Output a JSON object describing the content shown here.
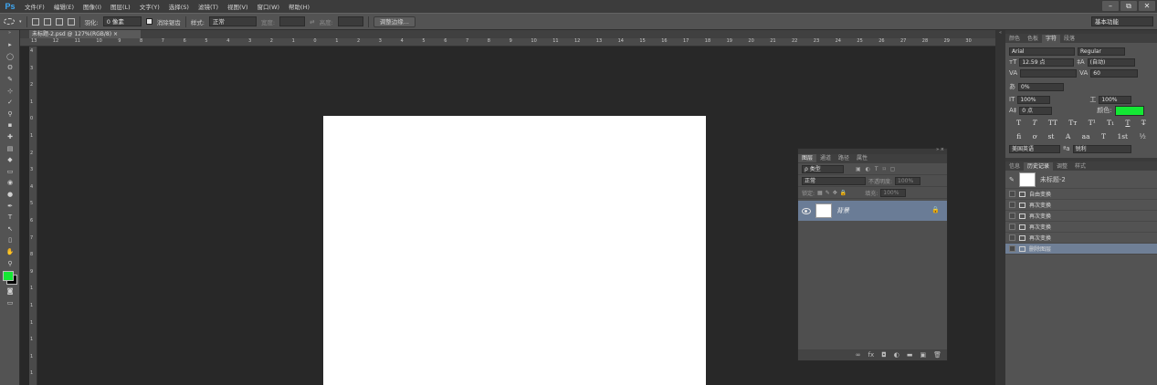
{
  "app": {
    "logo": "Ps"
  },
  "menu": [
    "文件(F)",
    "编辑(E)",
    "图像(I)",
    "图层(L)",
    "文字(Y)",
    "选择(S)",
    "滤镜(T)",
    "视图(V)",
    "窗口(W)",
    "帮助(H)"
  ],
  "window_controls": [
    "–",
    "⧉",
    "✕"
  ],
  "options": {
    "feather_label": "羽化:",
    "feather_value": "0 像素",
    "antialias_label": "消除锯齿",
    "style_label": "样式:",
    "style_value": "正常",
    "width_label": "宽度:",
    "height_label": "高度:",
    "refine_edge_button": "调整边缘...",
    "workspace": "基本功能"
  },
  "tools": [
    "▸",
    "◯",
    "ʘ",
    "✎",
    "⊹",
    "✓",
    "⚲",
    "▪",
    "✚",
    "▤",
    "◆",
    "▭",
    "◉",
    "●",
    "✒",
    "T",
    "↖",
    "▯",
    "✋",
    "⚲"
  ],
  "document": {
    "tab_title": "未标题-2.psd @ 127%(RGB/8) ×"
  },
  "ruler": {
    "h_ticks": [
      "13",
      "12",
      "11",
      "10",
      "9",
      "8",
      "7",
      "6",
      "5",
      "4",
      "3",
      "2",
      "1",
      "0",
      "1",
      "2",
      "3",
      "4",
      "5",
      "6",
      "7",
      "8",
      "9",
      "10",
      "11",
      "12",
      "13",
      "14",
      "15",
      "16",
      "17",
      "18",
      "19",
      "20",
      "21",
      "22",
      "23",
      "24",
      "25",
      "26",
      "27",
      "28",
      "29",
      "30"
    ],
    "v_ticks": [
      "4",
      "3",
      "2",
      "1",
      "0",
      "1",
      "2",
      "3",
      "4",
      "5",
      "6",
      "7",
      "8",
      "9",
      "1",
      "1",
      "1",
      "1",
      "1",
      "1"
    ]
  },
  "character_panel": {
    "tabs": [
      "颜色",
      "色板",
      "字符",
      "段落"
    ],
    "font_family": "Arial",
    "font_style": "Regular",
    "font_size": "12.59 点",
    "leading": "(自动)",
    "tracking": "60",
    "vertical_scale": "100%",
    "horizontal_scale": "100%",
    "baseline_label_value": "0%",
    "baseline_shift": "0 点",
    "color_label": "颜色:",
    "color_hex": "#14e834",
    "glyphs": [
      "T",
      "T",
      "TT",
      "Tт",
      "T¹",
      "T₁",
      "T",
      "T̶"
    ],
    "glyphs2": [
      "fi",
      "ơ",
      "st",
      "A",
      "aa",
      "T",
      "1st",
      "½"
    ],
    "language": "美国英语",
    "antialias_icon": "ªa",
    "antialias": "锐利"
  },
  "history_panel": {
    "tabs": [
      "信息",
      "历史记录",
      "调整",
      "样式"
    ],
    "snapshot": "未标题-2",
    "items": [
      "自由变换",
      "再次变换",
      "再次变换",
      "再次变换",
      "再次变换",
      "删除图层"
    ]
  },
  "layers_panel": {
    "tabs": [
      "图层",
      "通道",
      "路径",
      "属性"
    ],
    "filter": "ρ 类型",
    "blend_mode": "正常",
    "opacity_label": "不透明度:",
    "opacity": "100%",
    "lock_label": "锁定:",
    "fill_label": "填充:",
    "fill": "100%",
    "layer_name": "背景",
    "footer_icons": [
      "∞",
      "fx",
      "◘",
      "◐",
      "▬",
      "▣",
      "🗑"
    ]
  }
}
